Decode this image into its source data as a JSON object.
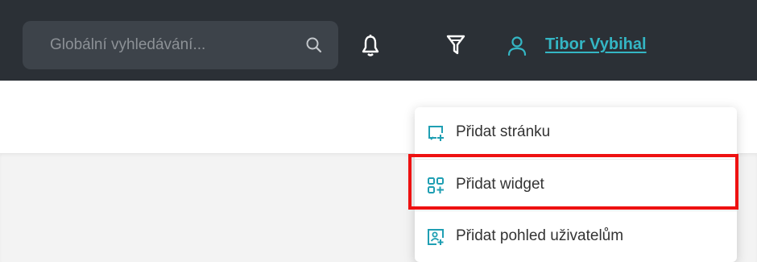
{
  "header": {
    "search": {
      "placeholder": "Globální vyhledávání...",
      "value": "",
      "icon": "search-icon"
    },
    "notifications_icon": "bell-icon",
    "filter_icon": "filter-icon",
    "user": {
      "icon": "user-icon",
      "name": "Tibor Vybihal"
    }
  },
  "dropdown_menu": {
    "items": [
      {
        "label": "Přidat stránku",
        "icon": "add-page-icon"
      },
      {
        "label": "Přidat widget",
        "icon": "add-widget-icon",
        "highlighted": true
      },
      {
        "label": "Přidat pohled uživatelům",
        "icon": "add-user-view-icon"
      }
    ]
  },
  "colors": {
    "topbar": "#2b3036",
    "search_background": "#3d434a",
    "accent": "#34b6c4",
    "highlight": "#ee1111"
  }
}
